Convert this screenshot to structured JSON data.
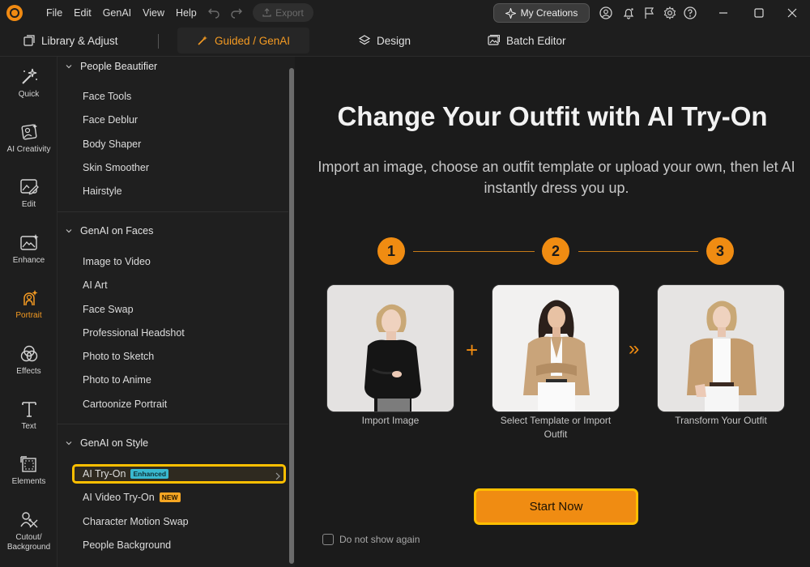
{
  "titlebar": {
    "menu": [
      "File",
      "Edit",
      "GenAI",
      "View",
      "Help"
    ],
    "export_label": "Export",
    "my_creations_label": "My Creations"
  },
  "modules": {
    "library": "Library & Adjust",
    "guided": "Guided / GenAI",
    "design": "Design",
    "batch": "Batch Editor"
  },
  "rail": [
    {
      "label": "Quick",
      "icon": "magic-wand-icon"
    },
    {
      "label": "AI Creativity",
      "icon": "ai-creativity-icon"
    },
    {
      "label": "Edit",
      "icon": "edit-image-icon"
    },
    {
      "label": "Enhance",
      "icon": "enhance-icon"
    },
    {
      "label": "Portrait",
      "icon": "portrait-icon",
      "active": true
    },
    {
      "label": "Effects",
      "icon": "effects-icon"
    },
    {
      "label": "Text",
      "icon": "text-icon"
    },
    {
      "label": "Elements",
      "icon": "elements-icon"
    },
    {
      "label": "Cutout/\nBackground",
      "icon": "cutout-icon"
    }
  ],
  "sections": [
    {
      "title": "People Beautifier",
      "items": [
        "Face Tools",
        "Face Deblur",
        "Body Shaper",
        "Skin Smoother",
        "Hairstyle"
      ]
    },
    {
      "title": "GenAI on Faces",
      "items": [
        "Image to Video",
        "AI Art",
        "Face Swap",
        "Professional Headshot",
        "Photo to Sketch",
        "Photo to Anime",
        "Cartoonize Portrait"
      ]
    },
    {
      "title": "GenAI on Style",
      "items": [
        "AI Try-On",
        "AI Video Try-On",
        "Character Motion Swap",
        "People Background"
      ]
    }
  ],
  "badges": {
    "enhanced": "Enhanced",
    "new": "NEW"
  },
  "main": {
    "headline": "Change Your Outfit with AI Try-On",
    "subline": "Import an image, choose an outfit template or upload your own, then let AI instantly dress you up.",
    "steps": [
      "1",
      "2",
      "3"
    ],
    "captions": [
      "Import Image",
      "Select Template or Import Outfit",
      "Transform Your Outfit"
    ],
    "plus": "+",
    "arrows": "»",
    "start_label": "Start Now",
    "dont_show_label": "Do not show again"
  },
  "colors": {
    "accent": "#f08c12",
    "highlight": "#ffbf00",
    "badge_enhanced": "#39b8cf"
  }
}
